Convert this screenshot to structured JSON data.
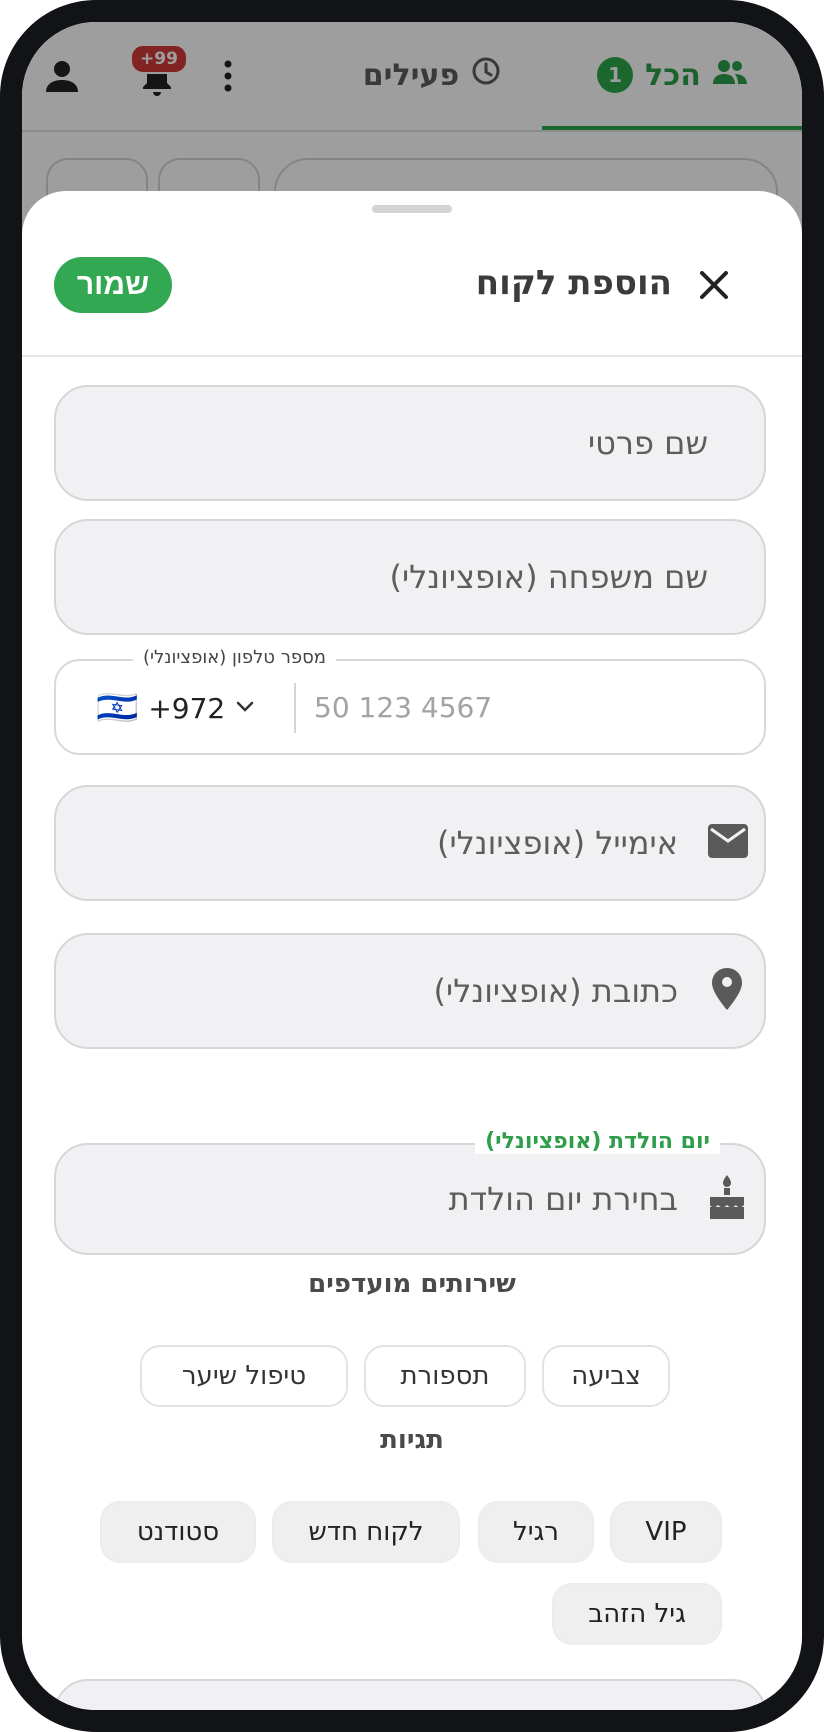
{
  "background_app": {
    "tabs": [
      {
        "label": "הכל",
        "count": "1"
      },
      {
        "label": "פעילים"
      }
    ],
    "notification_badge": "+99"
  },
  "sheet": {
    "title": "הוספת לקוח",
    "save_label": "שמור"
  },
  "form": {
    "first_name": {
      "placeholder": "שם פרטי"
    },
    "last_name": {
      "placeholder": "שם משפחה (אופציונלי)"
    },
    "phone": {
      "label": "מספר טלפון (אופציונלי)",
      "country_code": "+972",
      "flag": "🇮🇱",
      "placeholder": "50 123 4567"
    },
    "email": {
      "placeholder": "אימייל (אופציונלי)"
    },
    "address": {
      "placeholder": "כתובת (אופציונלי)"
    },
    "birthday": {
      "label": "יום הולדת (אופציונלי)",
      "placeholder": "בחירת יום הולדת"
    }
  },
  "services": {
    "title": "שירותים מועדפים",
    "items": [
      "צביעה",
      "תספורת",
      "טיפול שיער"
    ]
  },
  "tags": {
    "title": "תגיות",
    "items": [
      "VIP",
      "רגיל",
      "לקוח חדש",
      "סטודנט",
      "גיל הזהב"
    ]
  },
  "colors": {
    "accent_green": "#33a853",
    "field_bg": "#f1f1f3",
    "badge_red": "#d33b3b"
  }
}
